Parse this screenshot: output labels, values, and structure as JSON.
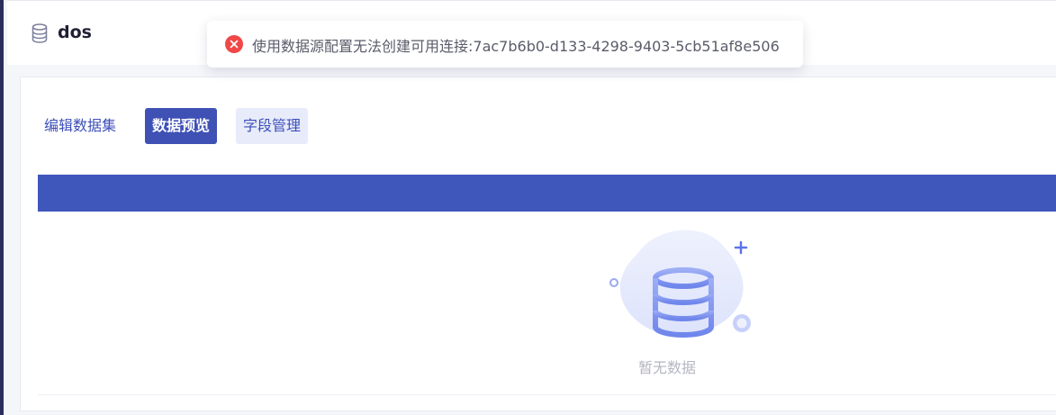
{
  "header": {
    "icon": "database-icon",
    "title": "dos"
  },
  "tabs": [
    {
      "label": "编辑数据集",
      "active": false
    },
    {
      "label": "数据预览",
      "active": true
    },
    {
      "label": "字段管理",
      "active": false
    }
  ],
  "table": {
    "empty_icon": "empty-database-icon",
    "empty_text": "暂无数据"
  },
  "toast": {
    "type": "error",
    "icon": "close-circle-icon",
    "message": "使用数据源配置无法创建可用连接:7ac7b6b0-d133-4298-9403-5cb51af8e506"
  },
  "colors": {
    "accent": "#3f51b5",
    "table_header": "#3f56bb",
    "error": "#f04848"
  }
}
